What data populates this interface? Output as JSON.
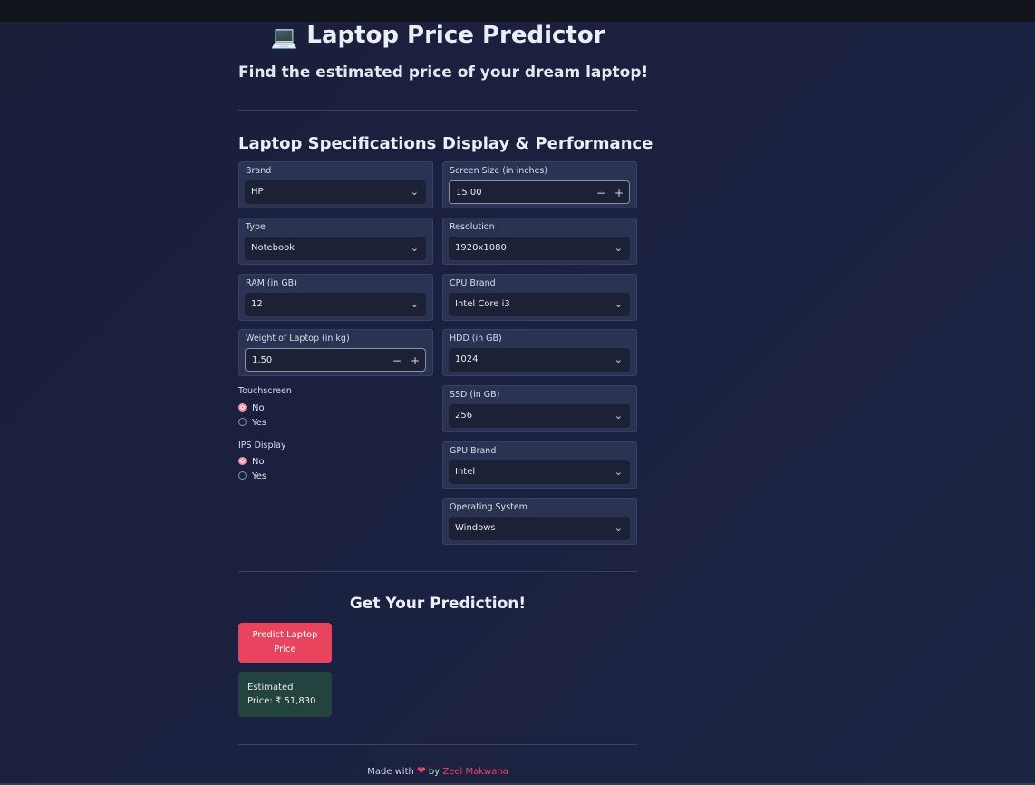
{
  "header": {
    "title_icon": "laptop-emoji",
    "title_icon_glyph": "💻",
    "title": "Laptop Price Predictor",
    "subtitle": "Find the estimated price of your dream laptop!"
  },
  "left_column": {
    "heading": "Laptop Specifications",
    "brand": {
      "label": "Brand",
      "value": "HP"
    },
    "type": {
      "label": "Type",
      "value": "Notebook"
    },
    "ram": {
      "label": "RAM (in GB)",
      "value": "12"
    },
    "weight": {
      "label": "Weight of Laptop (in kg)",
      "value": "1.50",
      "minus": "−",
      "plus": "+"
    },
    "touchscreen": {
      "label": "Touchscreen",
      "options": [
        "No",
        "Yes"
      ],
      "selected": "No"
    },
    "ips": {
      "label": "IPS Display",
      "options": [
        "No",
        "Yes"
      ],
      "selected": "No"
    }
  },
  "right_column": {
    "heading": "Display & Performance",
    "screen_size": {
      "label": "Screen Size (in inches)",
      "value": "15.00",
      "minus": "−",
      "plus": "+"
    },
    "resolution": {
      "label": "Resolution",
      "value": "1920x1080"
    },
    "cpu_brand": {
      "label": "CPU Brand",
      "value": "Intel Core i3"
    },
    "hdd": {
      "label": "HDD (in GB)",
      "value": "1024"
    },
    "ssd": {
      "label": "SSD (in GB)",
      "value": "256"
    },
    "gpu_brand": {
      "label": "GPU Brand",
      "value": "Intel"
    },
    "os": {
      "label": "Operating System",
      "value": "Windows"
    }
  },
  "prediction": {
    "heading": "Get Your Prediction!",
    "button_line1": "Predict Laptop",
    "button_line2": "Price",
    "result_line1": "Estimated",
    "result_line2": "Price: ₹ 51,830"
  },
  "footer": {
    "made_with": "Made with",
    "heart": "❤",
    "by": "by",
    "author": "Zeel Makwana"
  },
  "colors": {
    "background": "#1b2140",
    "card": "#2a3352",
    "accent": "#e8445e",
    "result_bg": "#23433f"
  },
  "icons": {
    "select_chevron": "chevron-down-icon",
    "radio_selected": "radio-selected",
    "radio_unselected": "radio-unselected",
    "heart": "heart-icon"
  }
}
